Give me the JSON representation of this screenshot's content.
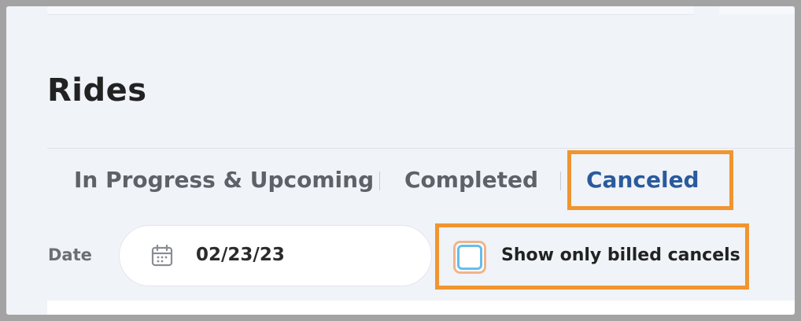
{
  "page": {
    "title": "Rides"
  },
  "tabs": [
    {
      "label": "In Progress & Upcoming",
      "active": false
    },
    {
      "label": "Completed",
      "active": false
    },
    {
      "label": "Canceled",
      "active": true
    }
  ],
  "filters": {
    "date_label": "Date",
    "date_value": "02/23/23",
    "billed_checkbox_label": "Show only billed cancels",
    "billed_checkbox_checked": false
  },
  "colors": {
    "accent": "#2a5a9c",
    "highlight": "#f0952f",
    "checkbox_focus": "#67bde8"
  },
  "icons": {
    "date": "calendar-icon"
  }
}
